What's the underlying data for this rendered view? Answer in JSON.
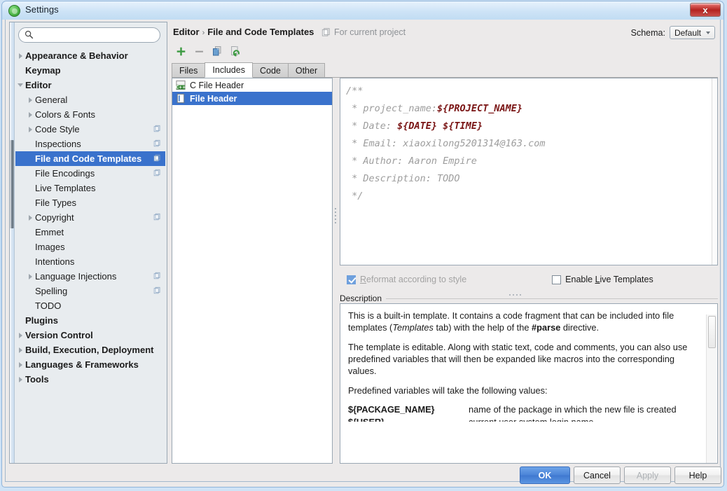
{
  "window": {
    "title": "Settings",
    "app_icon": "android-green-icon",
    "close_label": "x"
  },
  "sidebar": {
    "search": {
      "value": "",
      "placeholder": ""
    },
    "items": [
      {
        "label": "Appearance & Behavior",
        "level": 1,
        "twisty": "closed",
        "bold": true,
        "badge": false,
        "selected": false
      },
      {
        "label": "Keymap",
        "level": 1,
        "twisty": "none",
        "bold": true,
        "badge": false,
        "selected": false
      },
      {
        "label": "Editor",
        "level": 1,
        "twisty": "open",
        "bold": true,
        "badge": false,
        "selected": false
      },
      {
        "label": "General",
        "level": 2,
        "twisty": "closed",
        "bold": false,
        "badge": false,
        "selected": false
      },
      {
        "label": "Colors & Fonts",
        "level": 2,
        "twisty": "closed",
        "bold": false,
        "badge": false,
        "selected": false
      },
      {
        "label": "Code Style",
        "level": 2,
        "twisty": "closed",
        "bold": false,
        "badge": true,
        "selected": false
      },
      {
        "label": "Inspections",
        "level": 2,
        "twisty": "none",
        "bold": false,
        "badge": true,
        "selected": false
      },
      {
        "label": "File and Code Templates",
        "level": 2,
        "twisty": "none",
        "bold": false,
        "badge": true,
        "selected": true
      },
      {
        "label": "File Encodings",
        "level": 2,
        "twisty": "none",
        "bold": false,
        "badge": true,
        "selected": false
      },
      {
        "label": "Live Templates",
        "level": 2,
        "twisty": "none",
        "bold": false,
        "badge": false,
        "selected": false
      },
      {
        "label": "File Types",
        "level": 2,
        "twisty": "none",
        "bold": false,
        "badge": false,
        "selected": false
      },
      {
        "label": "Copyright",
        "level": 2,
        "twisty": "closed",
        "bold": false,
        "badge": true,
        "selected": false
      },
      {
        "label": "Emmet",
        "level": 2,
        "twisty": "none",
        "bold": false,
        "badge": false,
        "selected": false
      },
      {
        "label": "Images",
        "level": 2,
        "twisty": "none",
        "bold": false,
        "badge": false,
        "selected": false
      },
      {
        "label": "Intentions",
        "level": 2,
        "twisty": "none",
        "bold": false,
        "badge": false,
        "selected": false
      },
      {
        "label": "Language Injections",
        "level": 2,
        "twisty": "closed",
        "bold": false,
        "badge": true,
        "selected": false
      },
      {
        "label": "Spelling",
        "level": 2,
        "twisty": "none",
        "bold": false,
        "badge": true,
        "selected": false
      },
      {
        "label": "TODO",
        "level": 2,
        "twisty": "none",
        "bold": false,
        "badge": false,
        "selected": false
      },
      {
        "label": "Plugins",
        "level": 1,
        "twisty": "none",
        "bold": true,
        "badge": false,
        "selected": false
      },
      {
        "label": "Version Control",
        "level": 1,
        "twisty": "closed",
        "bold": true,
        "badge": false,
        "selected": false
      },
      {
        "label": "Build, Execution, Deployment",
        "level": 1,
        "twisty": "closed",
        "bold": true,
        "badge": false,
        "selected": false
      },
      {
        "label": "Languages & Frameworks",
        "level": 1,
        "twisty": "closed",
        "bold": true,
        "badge": false,
        "selected": false
      },
      {
        "label": "Tools",
        "level": 1,
        "twisty": "closed",
        "bold": true,
        "badge": false,
        "selected": false
      }
    ]
  },
  "header": {
    "breadcrumb_parent": "Editor",
    "breadcrumb_separator": "›",
    "breadcrumb_current": "File and Code Templates",
    "for_current_project": "For current project",
    "schema_label": "Schema:",
    "schema_value": "Default"
  },
  "toolbar": {
    "add_label": "+",
    "remove_label": "−",
    "copy_label": "copy-icon",
    "reset_label": "reset-icon"
  },
  "tabs": [
    {
      "label": "Files",
      "active": false
    },
    {
      "label": "Includes",
      "active": true
    },
    {
      "label": "Code",
      "active": false
    },
    {
      "label": "Other",
      "active": false
    }
  ],
  "template_list": [
    {
      "label": "C File Header",
      "icon": "cpp-file-icon",
      "selected": false
    },
    {
      "label": "File Header",
      "icon": "template-file-icon",
      "selected": true
    }
  ],
  "editor": {
    "lines": [
      {
        "text": "/**",
        "var": ""
      },
      {
        "text": " * project_name:",
        "var": "${PROJECT_NAME}"
      },
      {
        "text": " * Date: ",
        "var": "${DATE} ${TIME}"
      },
      {
        "text": " * Email: xiaoxilong5201314@163.com",
        "var": ""
      },
      {
        "text": " * Author: Aaron Empire",
        "var": ""
      },
      {
        "text": " * Description: TODO",
        "var": ""
      },
      {
        "text": " */",
        "var": ""
      }
    ]
  },
  "options": {
    "reformat_label": "Reformat according to style",
    "reformat_checked": true,
    "reformat_enabled": false,
    "live_templates_label": "Enable Live Templates",
    "live_templates_checked": false
  },
  "description": {
    "legend": "Description",
    "para1_a": "This is a built-in template. It contains a code fragment that can be included into file templates (",
    "para1_em": "Templates",
    "para1_b": " tab) with the help of the ",
    "para1_bold": "#parse",
    "para1_c": " directive.",
    "para2": "The template is editable. Along with static text, code and comments, you can also use predefined variables that will then be expanded like macros into the corresponding values.",
    "para3": "Predefined variables will take the following values:",
    "variables": [
      {
        "name": "${PACKAGE_NAME}",
        "desc": "name of the package in which the new file is created"
      },
      {
        "name": "${USER}",
        "desc": "current user system login name"
      }
    ]
  },
  "buttons": {
    "ok": "OK",
    "cancel": "Cancel",
    "apply": "Apply",
    "help": "Help"
  },
  "colors": {
    "selection_blue": "#3a72cc",
    "primary_button": "#4b84d8",
    "code_variable_red": "#7a1515",
    "code_text_gray": "#9d9d9d"
  }
}
